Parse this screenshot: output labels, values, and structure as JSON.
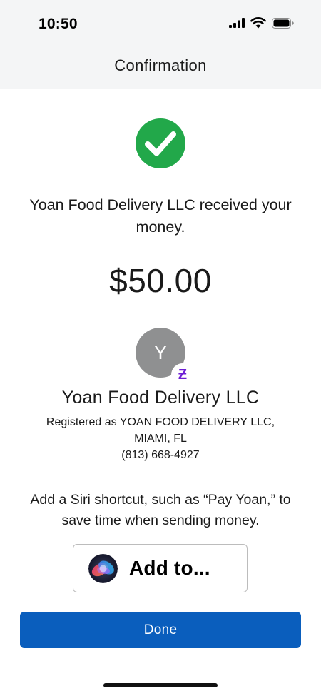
{
  "status_bar": {
    "time": "10:50",
    "signal_icon": "cellular-signal-icon",
    "wifi_icon": "wifi-icon",
    "battery_icon": "battery-icon"
  },
  "header": {
    "title": "Confirmation"
  },
  "confirmation": {
    "success_icon": "checkmark-circle-icon",
    "success_color": "#22a84a",
    "message": "Yoan Food Delivery LLC received your money.",
    "amount": "$50.00"
  },
  "recipient": {
    "avatar_initial": "Y",
    "avatar_color": "#8f9091",
    "badge_icon": "zelle-icon",
    "badge_glyph": "Ƶ",
    "badge_color": "#6d1ed4",
    "name": "Yoan Food Delivery LLC",
    "registered_line1": "Registered as YOAN FOOD DELIVERY LLC,",
    "registered_line2": "MIAMI, FL",
    "phone": "(813) 668-4927"
  },
  "siri": {
    "message": "Add a Siri shortcut, such as “Pay Yoan,” to save time when sending money.",
    "button_icon": "siri-icon",
    "button_label": "Add to..."
  },
  "actions": {
    "done_label": "Done",
    "accent_color": "#0a5ebd"
  }
}
